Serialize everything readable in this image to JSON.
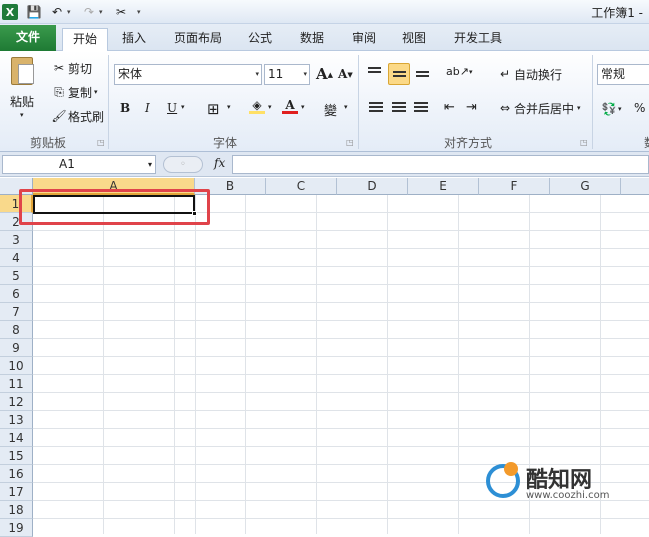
{
  "app": {
    "logo": "X",
    "window_title": "工作簿1 -"
  },
  "quick_access": {
    "save_icon": "💾",
    "undo_icon": "↶",
    "redo_icon": "↷",
    "tool_icon": "✂",
    "dropdown": "▾"
  },
  "tabs": [
    {
      "label": "文件"
    },
    {
      "label": "开始"
    },
    {
      "label": "插入"
    },
    {
      "label": "页面布局"
    },
    {
      "label": "公式"
    },
    {
      "label": "数据"
    },
    {
      "label": "审阅"
    },
    {
      "label": "视图"
    },
    {
      "label": "开发工具"
    }
  ],
  "clipboard": {
    "paste_label": "粘贴",
    "cut_label": "剪切",
    "copy_label": "复制",
    "format_painter_label": "格式刷",
    "group_label": "剪贴板",
    "cut_icon": "✂",
    "copy_icon": "⎘",
    "brush_icon": "🖌"
  },
  "font": {
    "name": "宋体",
    "size": "11",
    "grow_icon": "A",
    "shrink_icon": "A",
    "bold": "B",
    "italic": "I",
    "underline": "U",
    "border_icon": "⊞",
    "fill_icon": "◈",
    "color_icon": "A",
    "wen_icon": "變",
    "group_label": "字体",
    "font_color": "#e01f1f",
    "fill_color": "#ffe066"
  },
  "alignment": {
    "wrap_label": "自动换行",
    "merge_label": "合并后居中",
    "group_label": "对齐方式",
    "orientation_icon": "ab↗",
    "indent_dec": "⇤",
    "indent_inc": "⇥"
  },
  "number": {
    "format": "常规",
    "percent": "%",
    "group_label": "数"
  },
  "formula_bar": {
    "name_box": "A1",
    "fx": "fx",
    "value": ""
  },
  "grid": {
    "columns": [
      "A",
      "B",
      "C",
      "D",
      "E",
      "F",
      "G"
    ],
    "rows": [
      "1",
      "2",
      "3",
      "4",
      "5",
      "6",
      "7",
      "8",
      "9",
      "10",
      "11",
      "12",
      "13",
      "14",
      "15",
      "16",
      "17",
      "18",
      "19"
    ],
    "selected_cell": "A1"
  },
  "watermark": {
    "name": "酷知网",
    "url": "www.coozhi.com"
  },
  "colors": {
    "accent_green": "#1e7a34",
    "selection": "#f9d98b",
    "highlight": "#e0434a"
  }
}
